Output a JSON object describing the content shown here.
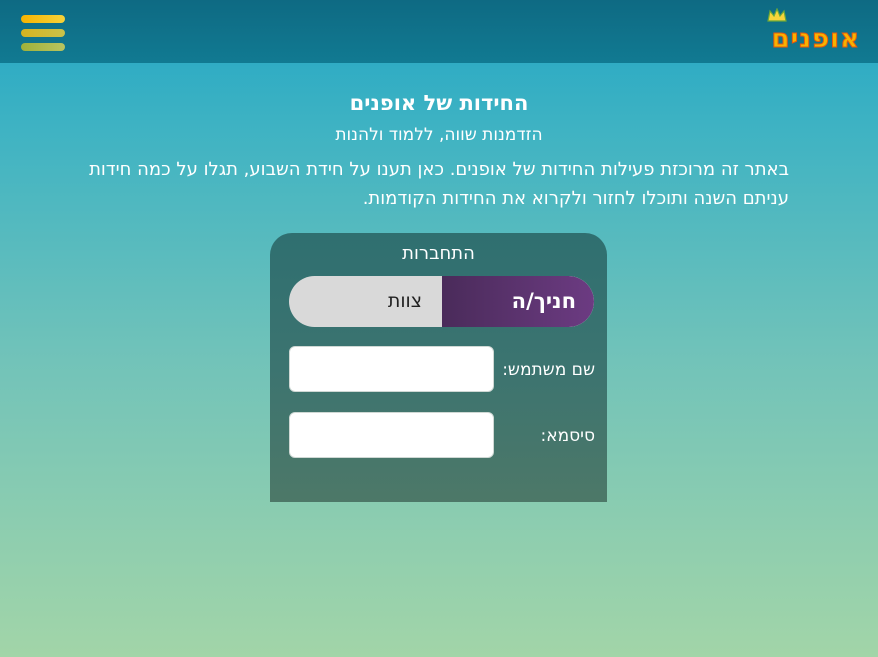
{
  "header": {
    "logo_text": "אופנים",
    "menu_icon": "hamburger-menu-icon",
    "colors": {
      "bar": "#117a92",
      "menu": "#f7b400",
      "logo": "#f7b300"
    }
  },
  "intro": {
    "title": "החידות של אופנים",
    "subtitle": "הזדמנות שווה, ללמוד ולהנות",
    "paragraph": "באתר זה מרוכזת פעילות החידות של אופנים. כאן תענו על חידת השבוע, תגלו על כמה חידות עניתם השנה ותוכלו לחזור ולקרוא את החידות הקודמות."
  },
  "login": {
    "title": "התחברות",
    "roles": {
      "student": "חניך/ה",
      "staff": "צוות",
      "selected": "student"
    },
    "username_label": "שם משתמש:",
    "username_value": "",
    "password_label": "סיסמא:",
    "password_value": ""
  }
}
